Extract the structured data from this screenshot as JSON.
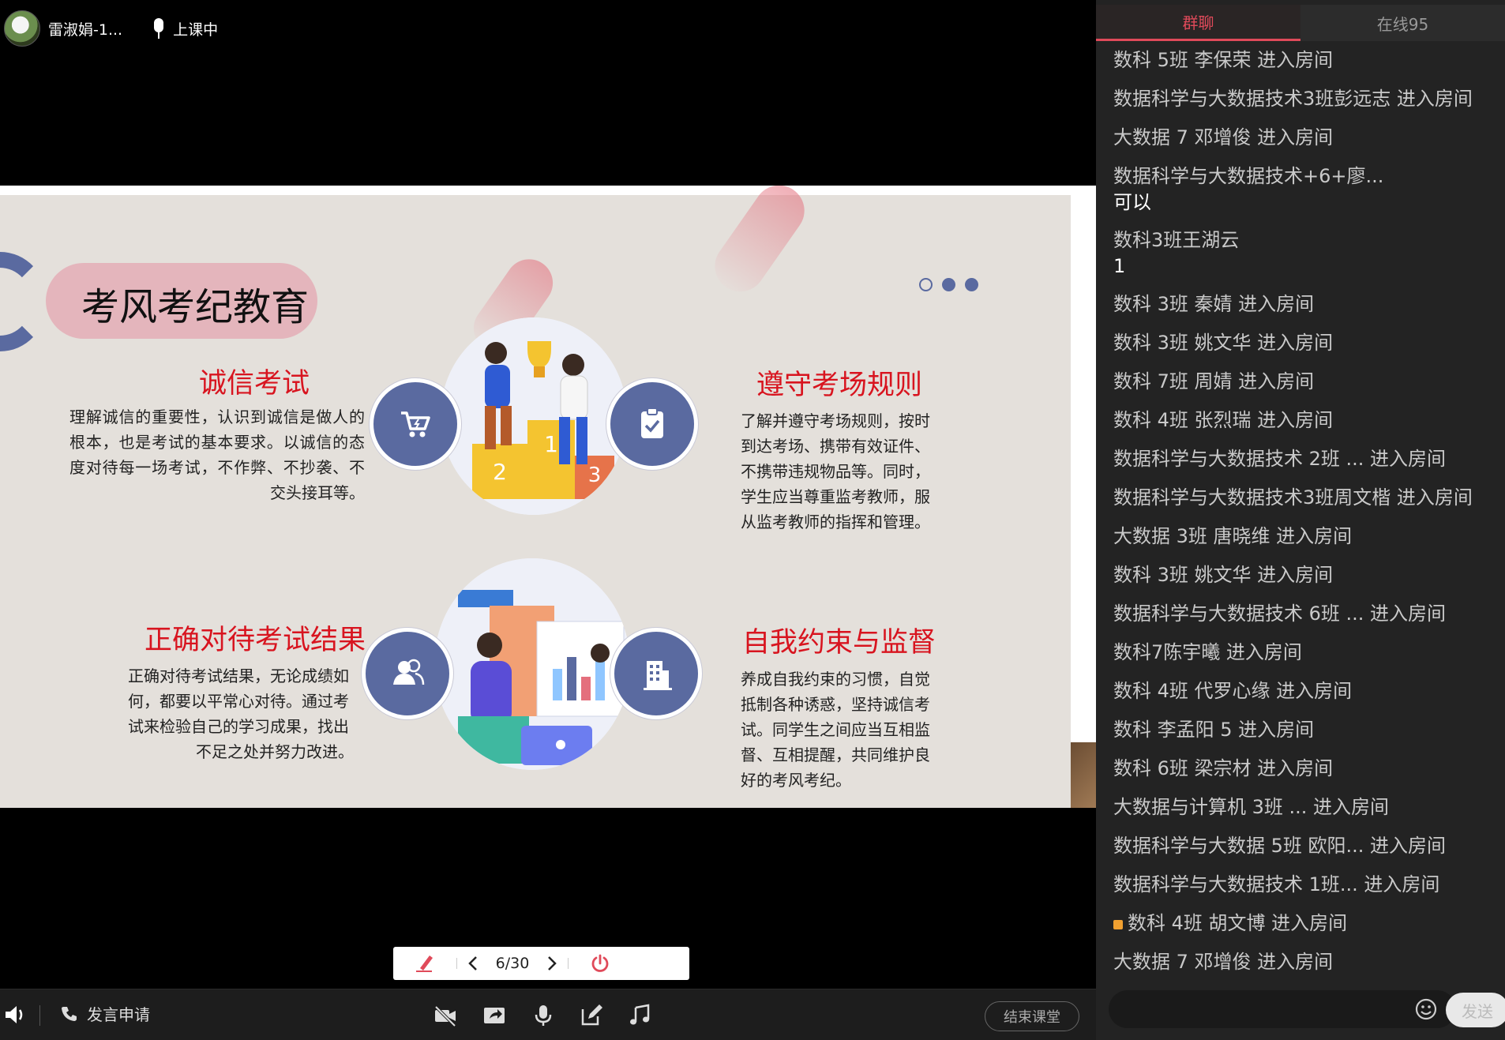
{
  "topbar": {
    "host_name": "雷淑娟-1...",
    "status": "上课中"
  },
  "slide": {
    "title": "考风考纪教育",
    "sections": [
      {
        "title": "诚信考试",
        "body": "理解诚信的重要性，认识到诚信是做人的根本，也是考试的基本要求。以诚信的态度对待每一场考试，不作弊、不抄袭、不交头接耳等。",
        "icon": "shopping-cart-icon"
      },
      {
        "title": "遵守考场规则",
        "body": "了解并遵守考场规则，按时到达考场、携带有效证件、不携带违规物品等。同时，学生应当尊重监考教师，服从监考教师的指挥和管理。",
        "icon": "clipboard-check-icon"
      },
      {
        "title": "正确对待考试结果",
        "body": "正确对待考试结果，无论成绩如何，都要以平常心对待。通过考试来检验自己的学习成果，找出不足之处并努力改进。",
        "icon": "users-icon"
      },
      {
        "title": "自我约束与监督",
        "body": "养成自我约束的习惯，自觉抵制各种诱惑，坚持诚信考试。同学生之间应当互相监督、互相提醒，共同维护良好的考风考纪。",
        "icon": "building-icon"
      }
    ]
  },
  "slide_toolbar": {
    "page_indicator": "6/30"
  },
  "bottombar": {
    "request_label": "发言申请",
    "end_class_label": "结束课堂"
  },
  "chat": {
    "tabs": [
      {
        "label": "群聊",
        "active": true
      },
      {
        "label": "在线95",
        "active": false
      }
    ],
    "messages": [
      {
        "text": "数科 5班 李保荣 进入房间"
      },
      {
        "text": "数据科学与大数据技术3班彭远志 进入房间"
      },
      {
        "text": "大数据 7 邓增俊 进入房间"
      },
      {
        "text": "数据科学与大数据技术+6+廖...",
        "content": "可以"
      },
      {
        "text": "数科3班王湖云",
        "content": "1"
      },
      {
        "text": "数科 3班 秦婧 进入房间"
      },
      {
        "text": "数科 3班 姚文华 进入房间"
      },
      {
        "text": "数科 7班 周婧 进入房间"
      },
      {
        "text": "数科 4班 张烈瑞 进入房间"
      },
      {
        "text": "数据科学与大数据技术 2班 ... 进入房间"
      },
      {
        "text": "数据科学与大数据技术3班周文楷 进入房间"
      },
      {
        "text": "大数据 3班 唐晓维 进入房间"
      },
      {
        "text": "数科 3班 姚文华 进入房间"
      },
      {
        "text": "数据科学与大数据技术 6班 ... 进入房间"
      },
      {
        "text": "数科7陈宇曦 进入房间"
      },
      {
        "text": "数科 4班 代罗心缘 进入房间"
      },
      {
        "text": "数科 李孟阳 5 进入房间"
      },
      {
        "text": "数科  6班  梁宗材 进入房间"
      },
      {
        "text": "大数据与计算机    3班 ... 进入房间"
      },
      {
        "text": "数据科学与大数据 5班 欧阳... 进入房间"
      },
      {
        "text": "数据科学与大数据技术  1班... 进入房间"
      },
      {
        "text": "数科 4班 胡文博 进入房间",
        "badge": true
      },
      {
        "text": "大数据 7 邓增俊 进入房间"
      }
    ],
    "input_placeholder": "",
    "send_label": "发送"
  }
}
